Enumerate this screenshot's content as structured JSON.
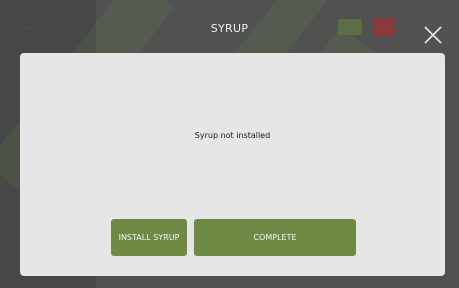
{
  "header": {
    "title": "SYRUP",
    "dim_label": "········",
    "close_icon": "close-icon"
  },
  "dialog": {
    "message": "Syrup not installed",
    "install_label": "INSTALL SYRUP",
    "complete_label": "COMPLETE"
  },
  "colors": {
    "accent_button": "#6f8a44",
    "dialog_background": "#e6e6e6",
    "screen_background": "#4d4d4d"
  }
}
